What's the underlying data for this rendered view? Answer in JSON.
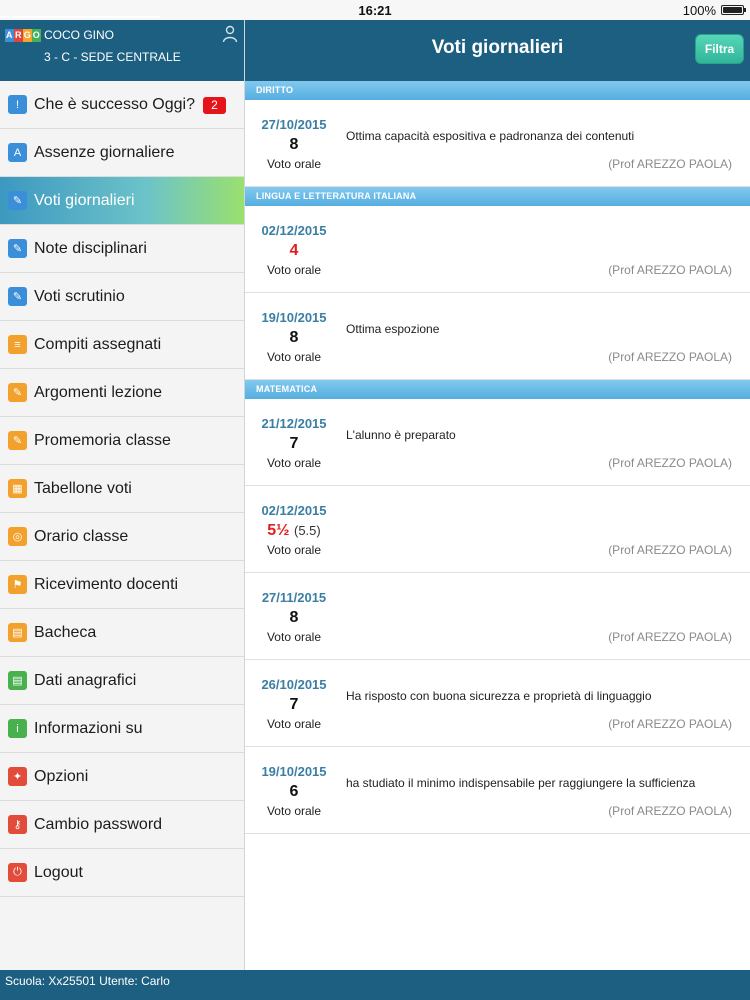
{
  "status": {
    "time": "16:21",
    "battery": "100%"
  },
  "logo": {
    "letters": [
      "A",
      "R",
      "G",
      "O"
    ],
    "colors": [
      "#3d8fd6",
      "#e2433a",
      "#f2a62b",
      "#44b05a"
    ]
  },
  "user": {
    "name": "COCO GINO",
    "class": "3 - C - SEDE CENTRALE"
  },
  "menu": [
    {
      "label": "Che è successo Oggi?",
      "icon": "info-icon",
      "color": "#3b8fd8",
      "glyph": "!",
      "badge": "2"
    },
    {
      "label": "Assenze giornaliere",
      "icon": "absences-icon",
      "color": "#3b8fd8",
      "glyph": "A"
    },
    {
      "label": "Voti giornalieri",
      "icon": "grades-icon",
      "color": "#3b8fd8",
      "glyph": "✎",
      "active": true
    },
    {
      "label": "Note disciplinari",
      "icon": "notes-icon",
      "color": "#3b8fd8",
      "glyph": "✎"
    },
    {
      "label": "Voti scrutinio",
      "icon": "scrutiny-icon",
      "color": "#3b8fd8",
      "glyph": "✎"
    },
    {
      "label": "Compiti assegnati",
      "icon": "homework-icon",
      "color": "#f2a12d",
      "glyph": "≡"
    },
    {
      "label": "Argomenti lezione",
      "icon": "topics-icon",
      "color": "#f2a12d",
      "glyph": "✎"
    },
    {
      "label": "Promemoria classe",
      "icon": "reminder-icon",
      "color": "#f2a12d",
      "glyph": "✎"
    },
    {
      "label": "Tabellone voti",
      "icon": "board-icon",
      "color": "#f2a12d",
      "glyph": "▦"
    },
    {
      "label": "Orario classe",
      "icon": "timetable-icon",
      "color": "#f2a12d",
      "glyph": "◎"
    },
    {
      "label": "Ricevimento docenti",
      "icon": "meeting-icon",
      "color": "#f2a12d",
      "glyph": "⚑"
    },
    {
      "label": "Bacheca",
      "icon": "bulletin-icon",
      "color": "#f2a12d",
      "glyph": "▤"
    },
    {
      "label": "Dati anagrafici",
      "icon": "personal-data-icon",
      "color": "#49b04e",
      "glyph": "▤"
    },
    {
      "label": "Informazioni su",
      "icon": "about-icon",
      "color": "#49b04e",
      "glyph": "i"
    },
    {
      "label": "Opzioni",
      "icon": "wrench-icon",
      "color": "#e24c3b",
      "glyph": "✦"
    },
    {
      "label": "Cambio password",
      "icon": "key-icon",
      "color": "#e24c3b",
      "glyph": "⚷"
    },
    {
      "label": "Logout",
      "icon": "power-icon",
      "color": "#e24c3b",
      "glyph": "⏻"
    }
  ],
  "main": {
    "title": "Voti giornalieri",
    "filter_label": "Filtra",
    "sections": [
      {
        "subject": "DIRITTO",
        "entries": [
          {
            "date": "27/10/2015",
            "grade": "8",
            "decimal": "",
            "red": false,
            "type": "Voto orale",
            "note": "Ottima capacità espositiva e padronanza dei contenuti",
            "teacher": "(Prof AREZZO PAOLA)"
          }
        ]
      },
      {
        "subject": "LINGUA E LETTERATURA ITALIANA",
        "entries": [
          {
            "date": "02/12/2015",
            "grade": "4",
            "decimal": "",
            "red": true,
            "type": "Voto orale",
            "note": "",
            "teacher": "(Prof AREZZO PAOLA)"
          },
          {
            "date": "19/10/2015",
            "grade": "8",
            "decimal": "",
            "red": false,
            "type": "Voto orale",
            "note": "Ottima espozione",
            "teacher": "(Prof AREZZO PAOLA)"
          }
        ]
      },
      {
        "subject": "MATEMATICA",
        "entries": [
          {
            "date": "21/12/2015",
            "grade": "7",
            "decimal": "",
            "red": false,
            "type": "Voto orale",
            "note": "L'alunno è preparato",
            "teacher": "(Prof AREZZO PAOLA)"
          },
          {
            "date": "02/12/2015",
            "grade": "5½",
            "decimal": "(5.5)",
            "red": true,
            "type": "Voto orale",
            "note": "",
            "teacher": "(Prof AREZZO PAOLA)"
          },
          {
            "date": "27/11/2015",
            "grade": "8",
            "decimal": "",
            "red": false,
            "type": "Voto orale",
            "note": "",
            "teacher": "(Prof AREZZO PAOLA)"
          },
          {
            "date": "26/10/2015",
            "grade": "7",
            "decimal": "",
            "red": false,
            "type": "Voto orale",
            "note": "Ha risposto con buona sicurezza e proprietà di linguaggio",
            "teacher": "(Prof AREZZO PAOLA)"
          },
          {
            "date": "19/10/2015",
            "grade": "6",
            "decimal": "",
            "red": false,
            "type": "Voto orale",
            "note": "ha studiato il minimo indispensabile per raggiungere la sufficienza",
            "teacher": "(Prof AREZZO PAOLA)"
          }
        ]
      }
    ]
  },
  "footer": {
    "text": "Scuola: Xx25501 Utente: Carlo"
  }
}
